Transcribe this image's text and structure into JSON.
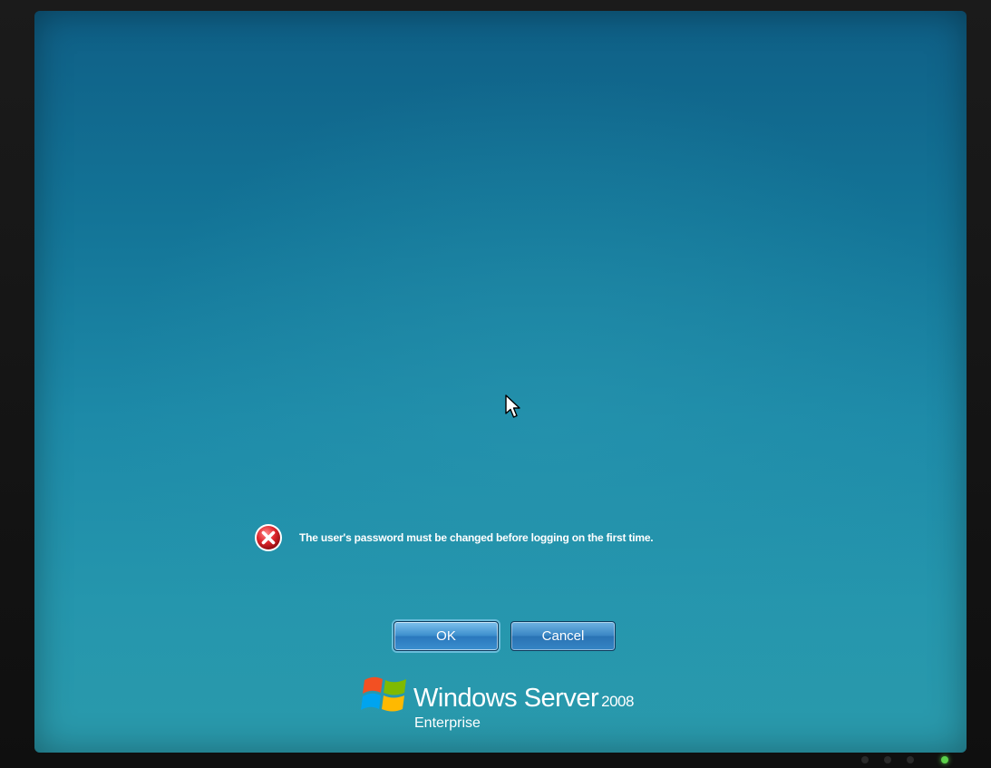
{
  "dialog": {
    "error_message": "The user's password must be changed before logging on the first time.",
    "error_icon": "error-x-icon",
    "ok_label": "OK",
    "cancel_label": "Cancel"
  },
  "branding": {
    "product_name": "Windows Server",
    "product_year": "2008",
    "edition": "Enterprise",
    "logo_icon": "windows-flag-logo"
  },
  "colors": {
    "screen_top": "#0f5f86",
    "screen_bottom": "#2a9aac",
    "error_red": "#d8282e",
    "button_blue": "#2a78bd",
    "power_led": "#5bd04a"
  }
}
